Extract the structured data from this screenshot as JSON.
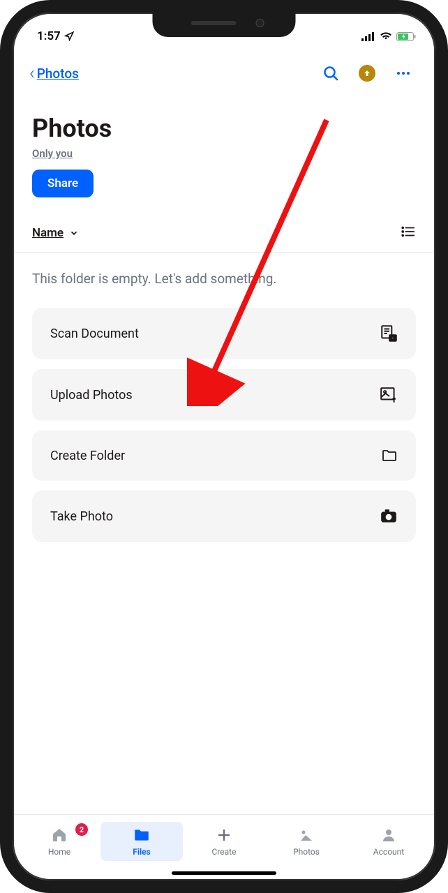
{
  "status": {
    "time": "1:57"
  },
  "nav": {
    "back_label": "Photos"
  },
  "header": {
    "title": "Photos",
    "access": "Only you",
    "share_label": "Share"
  },
  "sort": {
    "label": "Name"
  },
  "empty": {
    "message": "This folder is empty. Let's add something."
  },
  "actions": [
    {
      "label": "Scan Document",
      "icon": "scan"
    },
    {
      "label": "Upload Photos",
      "icon": "upload"
    },
    {
      "label": "Create Folder",
      "icon": "folder"
    },
    {
      "label": "Take Photo",
      "icon": "camera"
    }
  ],
  "tabs": {
    "home": {
      "label": "Home",
      "badge": "2"
    },
    "files": {
      "label": "Files"
    },
    "create": {
      "label": "Create"
    },
    "photos": {
      "label": "Photos"
    },
    "account": {
      "label": "Account"
    }
  }
}
